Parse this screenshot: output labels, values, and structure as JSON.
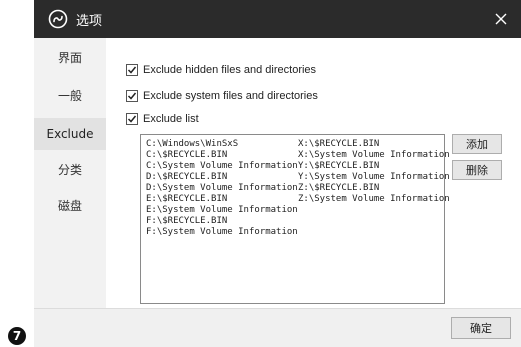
{
  "step_badge": "7",
  "window": {
    "title": "选项",
    "app_icon": "swirl-logo-icon",
    "close_icon": "close-icon"
  },
  "sidebar": {
    "items": [
      {
        "label": "界面",
        "active": false
      },
      {
        "label": "一般",
        "active": false
      },
      {
        "label": "Exclude",
        "active": true
      },
      {
        "label": "分类",
        "active": false
      },
      {
        "label": "磁盘",
        "active": false
      }
    ]
  },
  "options": {
    "exclude_hidden": {
      "label": "Exclude hidden files and directories",
      "checked": true
    },
    "exclude_system": {
      "label": "Exclude system files and directories",
      "checked": true
    },
    "exclude_list": {
      "label": "Exclude list",
      "checked": true
    }
  },
  "exclude_list": {
    "column1": [
      "C:\\Windows\\WinSxS",
      "C:\\$RECYCLE.BIN",
      "C:\\System Volume Information",
      "D:\\$RECYCLE.BIN",
      "D:\\System Volume Information",
      "E:\\$RECYCLE.BIN",
      "E:\\System Volume Information",
      "F:\\$RECYCLE.BIN",
      "F:\\System Volume Information"
    ],
    "column2": [
      "X:\\$RECYCLE.BIN",
      "X:\\System Volume Information",
      "Y:\\$RECYCLE.BIN",
      "Y:\\System Volume Information",
      "Z:\\$RECYCLE.BIN",
      "Z:\\System Volume Information"
    ]
  },
  "buttons": {
    "add": "添加",
    "delete": "删除",
    "ok": "确定"
  },
  "colors": {
    "titlebar": "#2b2b2b",
    "sidebar": "#f2f2f2",
    "sidebar_active": "#e2e2e2",
    "footer": "#f0f0f0"
  }
}
